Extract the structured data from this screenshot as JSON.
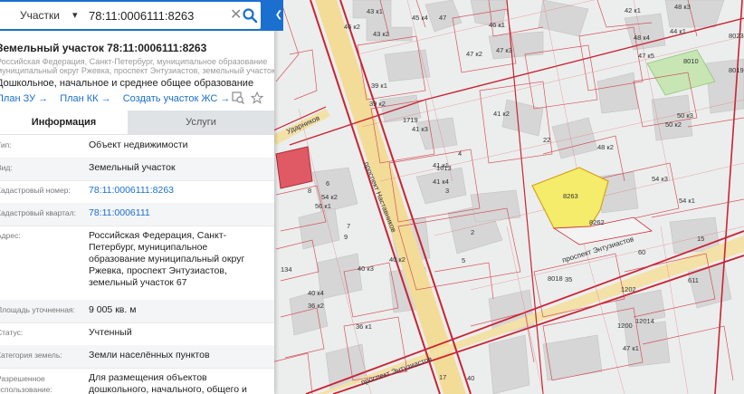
{
  "search": {
    "layer": "Участки",
    "query": "78:11:0006111:8263"
  },
  "card": {
    "title": "Земельный участок 78:11:0006111:8263",
    "address_lines": [
      "Российская Федерация, Санкт-Петербург, муниципальное образование",
      "муниципальный округ Ржевка, проспект Энтузиастов, земельный участок 67"
    ],
    "purpose": "Дошкольное, начальное и среднее общее образование",
    "links": [
      "План ЗУ →",
      "План КК →",
      "Создать участок ЖС →"
    ]
  },
  "tabs": {
    "info": "Информация",
    "services": "Услуги"
  },
  "attributes": [
    {
      "label": "Тип:",
      "value": "Объект недвижимости"
    },
    {
      "label": "Вид:",
      "value": "Земельный участок"
    },
    {
      "label": "Кадастровый номер:",
      "value": "78:11:0006111:8263",
      "link": true
    },
    {
      "label": "Кадастровый квартал:",
      "value": "78:11:0006111",
      "link": true
    },
    {
      "label": "Адрес:",
      "value": "Российская Федерация, Санкт-Петербург, муниципальное образование муниципальный округ Ржевка, проспект Энтузиастов, земельный участок 67"
    },
    {
      "label": "Площадь уточненная:",
      "value": "9 005 кв. м"
    },
    {
      "label": "Статус:",
      "value": "Учтенный"
    },
    {
      "label": "Категория земель:",
      "value": "Земли населённых пунктов"
    },
    {
      "label": "Разрешенное использование:",
      "value": "Для размещения объектов дошкольного, начального, общего и"
    }
  ],
  "map": {
    "highlight_parcel": "8263",
    "neighbor_parcel": "8262",
    "building_labels": [
      "43 к1",
      "46 к2",
      "43 к2",
      "45 к4",
      "47",
      "46 к1",
      "39 к1",
      "39 к2",
      "41 к3",
      "41 к2",
      "41 к4",
      "41 к1",
      "2",
      "3",
      "6",
      "8",
      "4",
      "5",
      "7",
      "9",
      "134",
      "40 к4",
      "40 к3",
      "40 к2",
      "42 к1",
      "44 к1",
      "48 к4",
      "48 к3",
      "50 к3",
      "50 к2",
      "48 к2",
      "54 к3",
      "54 к1",
      "54 к2",
      "56 к1",
      "36 к2",
      "36 к1",
      "40",
      "17",
      "35",
      "22",
      "15",
      "60",
      "611",
      "1202",
      "12014",
      "1200",
      "47 к1",
      "47 к2",
      "47 к3",
      "47 к5",
      "8010",
      "8023",
      "8019",
      "8018",
      "1719",
      "1613"
    ],
    "street_labels": [
      "проспект Наставников",
      "проспект Энтузиастов",
      "проспект Энтузиастов",
      "Ударников"
    ],
    "colors": {
      "parcel_line": "#cc2a3a",
      "highlight": "#f4ec6a",
      "road": "#f2d892",
      "building": "#d8d8d8"
    }
  }
}
